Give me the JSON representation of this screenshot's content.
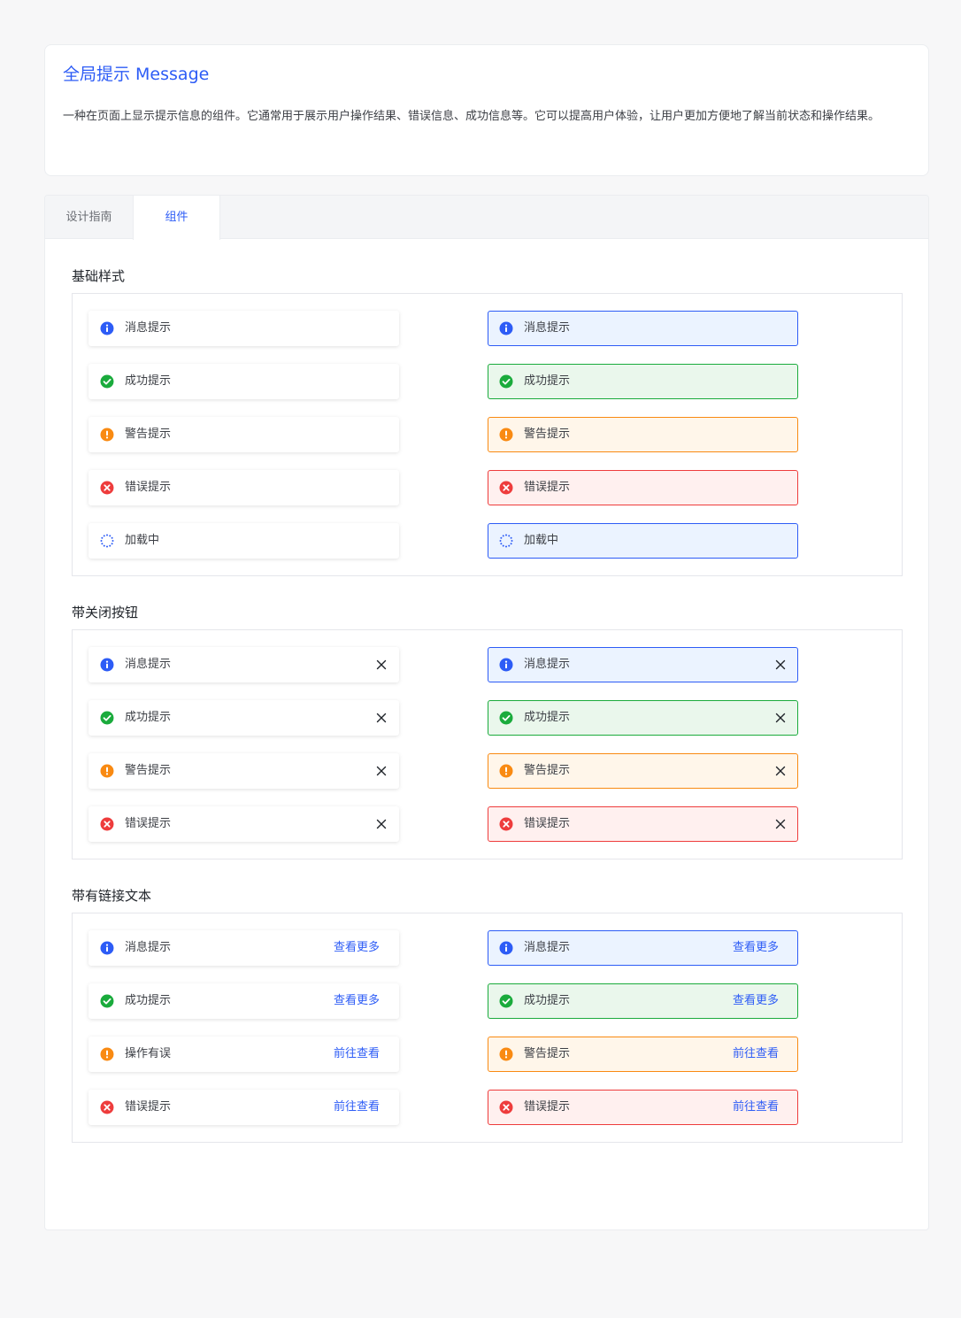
{
  "header": {
    "title": "全局提示 Message",
    "description": "一种在页面上显示提示信息的组件。它通常用于展示用户操作结果、错误信息、成功信息等。它可以提高用户体验，让用户更加方便地了解当前状态和操作结果。"
  },
  "tabs": [
    {
      "label": "设计指南",
      "active": false
    },
    {
      "label": "组件",
      "active": true
    }
  ],
  "colors": {
    "info": "#2d5cf6",
    "success": "#1aab3c",
    "warning": "#f98a12",
    "error": "#ee3c3c",
    "link": "#2d5cf6"
  },
  "sections": [
    {
      "title": "基础样式",
      "plain": [
        {
          "type": "info",
          "icon": "info-icon",
          "text": "消息提示"
        },
        {
          "type": "success",
          "icon": "check-circle-icon",
          "text": "成功提示"
        },
        {
          "type": "warning",
          "icon": "exclamation-circle-icon",
          "text": "警告提示"
        },
        {
          "type": "error",
          "icon": "x-circle-icon",
          "text": "错误提示"
        },
        {
          "type": "loading",
          "icon": "loading-spinner-icon",
          "text": "加载中"
        }
      ],
      "bordered": [
        {
          "type": "info",
          "icon": "info-icon",
          "text": "消息提示"
        },
        {
          "type": "success",
          "icon": "check-circle-icon",
          "text": "成功提示"
        },
        {
          "type": "warning",
          "icon": "exclamation-circle-icon",
          "text": "警告提示"
        },
        {
          "type": "error",
          "icon": "x-circle-icon",
          "text": "错误提示"
        },
        {
          "type": "loading",
          "icon": "loading-spinner-icon",
          "text": "加载中"
        }
      ]
    },
    {
      "title": "带关闭按钮",
      "plain": [
        {
          "type": "info",
          "icon": "info-icon",
          "text": "消息提示",
          "close": true
        },
        {
          "type": "success",
          "icon": "check-circle-icon",
          "text": "成功提示",
          "close": true
        },
        {
          "type": "warning",
          "icon": "exclamation-circle-icon",
          "text": "警告提示",
          "close": true
        },
        {
          "type": "error",
          "icon": "x-circle-icon",
          "text": "错误提示",
          "close": true
        }
      ],
      "bordered": [
        {
          "type": "info",
          "icon": "info-icon",
          "text": "消息提示",
          "close": true
        },
        {
          "type": "success",
          "icon": "check-circle-icon",
          "text": "成功提示",
          "close": true
        },
        {
          "type": "warning",
          "icon": "exclamation-circle-icon",
          "text": "警告提示",
          "close": true
        },
        {
          "type": "error",
          "icon": "x-circle-icon",
          "text": "错误提示",
          "close": true
        }
      ]
    },
    {
      "title": "带有链接文本",
      "plain": [
        {
          "type": "info",
          "icon": "info-icon",
          "text": "消息提示",
          "link": "查看更多"
        },
        {
          "type": "success",
          "icon": "check-circle-icon",
          "text": "成功提示",
          "link": "查看更多"
        },
        {
          "type": "warning",
          "icon": "exclamation-circle-icon",
          "text": "操作有误",
          "link": "前往查看"
        },
        {
          "type": "error",
          "icon": "x-circle-icon",
          "text": "错误提示",
          "link": "前往查看"
        }
      ],
      "bordered": [
        {
          "type": "info",
          "icon": "info-icon",
          "text": "消息提示",
          "link": "查看更多"
        },
        {
          "type": "success",
          "icon": "check-circle-icon",
          "text": "成功提示",
          "link": "查看更多"
        },
        {
          "type": "warning",
          "icon": "exclamation-circle-icon",
          "text": "警告提示",
          "link": "前往查看"
        },
        {
          "type": "error",
          "icon": "x-circle-icon",
          "text": "错误提示",
          "link": "前往查看"
        }
      ]
    }
  ]
}
